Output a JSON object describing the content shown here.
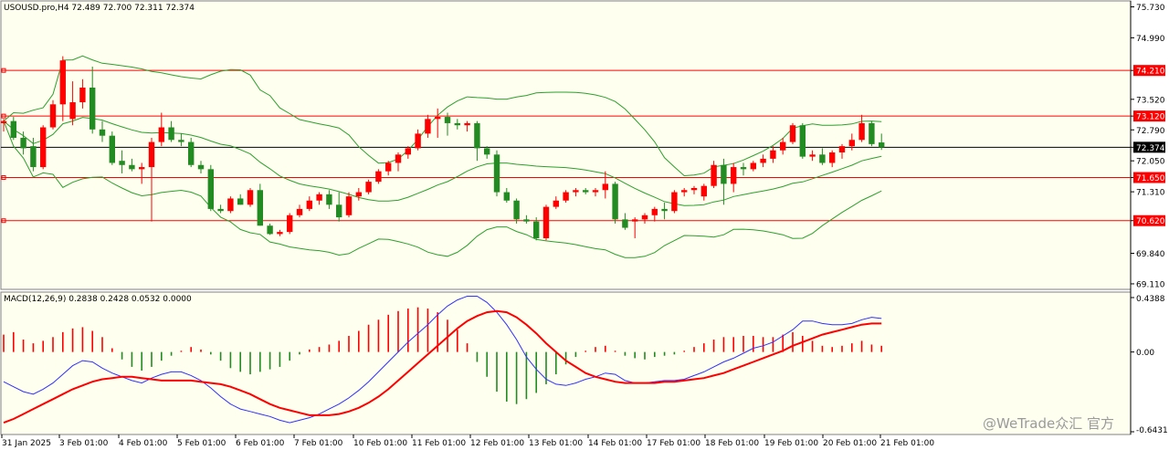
{
  "chart_data": {
    "type": "candlestick",
    "symbol_header": "USOUSD.pro,H4  72.489 72.700 72.311 72.374",
    "macd_header": "MACD(12,26,9) 0.2838 0.2428 0.0532 0.0000",
    "price_axis_labels": [
      "75.730",
      "74.990",
      "74.210",
      "73.520",
      "73.120",
      "72.790",
      "72.374",
      "72.050",
      "71.650",
      "71.310",
      "70.620",
      "69.840",
      "69.110"
    ],
    "macd_axis_labels": [
      "0.4388",
      "0.00",
      "-0.6431"
    ],
    "time_labels": [
      "31 Jan 2025",
      "3 Feb 01:00",
      "4 Feb 01:00",
      "5 Feb 01:00",
      "6 Feb 01:00",
      "7 Feb 01:00",
      "10 Feb 01:00",
      "11 Feb 01:00",
      "12 Feb 01:00",
      "13 Feb 01:00",
      "14 Feb 01:00",
      "17 Feb 01:00",
      "18 Feb 01:00",
      "19 Feb 01:00",
      "20 Feb 01:00",
      "21 Feb 01:00"
    ],
    "price_range": [
      69.0,
      75.85
    ],
    "macd_range": [
      -0.6431,
      0.4388
    ],
    "horizontal_levels": [
      {
        "value": 74.21,
        "label": "74.210",
        "color": "#ff0000"
      },
      {
        "value": 73.12,
        "label": "73.120",
        "color": "#ff0000"
      },
      {
        "value": 71.65,
        "label": "71.650",
        "color": "#ff0000"
      },
      {
        "value": 70.62,
        "label": "70.620",
        "color": "#ff0000"
      },
      {
        "value": 72.374,
        "label": "72.374",
        "color": "#000000"
      }
    ],
    "bollinger_color": "#2ca02c",
    "bull_color": "#ff0000",
    "bear_color": "#228b22",
    "macd_signal_color": "#ff0000",
    "macd_line_color": "#3030ff",
    "candles": [
      {
        "o": 72.95,
        "h": 73.05,
        "l": 72.75,
        "c": 73.0
      },
      {
        "o": 73.0,
        "h": 73.1,
        "l": 72.55,
        "c": 72.6
      },
      {
        "o": 72.6,
        "h": 72.75,
        "l": 72.2,
        "c": 72.35
      },
      {
        "o": 72.4,
        "h": 72.6,
        "l": 71.8,
        "c": 71.9
      },
      {
        "o": 71.9,
        "h": 72.9,
        "l": 71.85,
        "c": 72.85
      },
      {
        "o": 72.85,
        "h": 73.5,
        "l": 72.8,
        "c": 73.4
      },
      {
        "o": 73.4,
        "h": 74.55,
        "l": 73.0,
        "c": 74.45
      },
      {
        "o": 73.05,
        "h": 73.95,
        "l": 72.9,
        "c": 73.45
      },
      {
        "o": 73.45,
        "h": 74.0,
        "l": 73.3,
        "c": 73.8
      },
      {
        "o": 73.8,
        "h": 74.3,
        "l": 72.7,
        "c": 72.8
      },
      {
        "o": 72.8,
        "h": 73.0,
        "l": 72.5,
        "c": 72.65
      },
      {
        "o": 72.65,
        "h": 72.75,
        "l": 71.95,
        "c": 72.0
      },
      {
        "o": 72.05,
        "h": 72.3,
        "l": 71.75,
        "c": 71.95
      },
      {
        "o": 71.95,
        "h": 72.1,
        "l": 71.8,
        "c": 71.85
      },
      {
        "o": 71.85,
        "h": 72.0,
        "l": 71.5,
        "c": 71.9
      },
      {
        "o": 71.9,
        "h": 72.6,
        "l": 70.6,
        "c": 72.5
      },
      {
        "o": 72.5,
        "h": 73.2,
        "l": 72.4,
        "c": 72.85
      },
      {
        "o": 72.85,
        "h": 73.0,
        "l": 72.5,
        "c": 72.55
      },
      {
        "o": 72.55,
        "h": 72.7,
        "l": 72.4,
        "c": 72.5
      },
      {
        "o": 72.5,
        "h": 72.6,
        "l": 71.9,
        "c": 71.95
      },
      {
        "o": 71.95,
        "h": 72.05,
        "l": 71.75,
        "c": 71.85
      },
      {
        "o": 71.85,
        "h": 71.95,
        "l": 70.85,
        "c": 70.9
      },
      {
        "o": 70.9,
        "h": 71.0,
        "l": 70.8,
        "c": 70.85
      },
      {
        "o": 70.85,
        "h": 71.2,
        "l": 70.8,
        "c": 71.15
      },
      {
        "o": 71.15,
        "h": 71.25,
        "l": 71.0,
        "c": 71.0
      },
      {
        "o": 71.0,
        "h": 71.4,
        "l": 70.95,
        "c": 71.35
      },
      {
        "o": 71.35,
        "h": 71.5,
        "l": 70.5,
        "c": 70.5
      },
      {
        "o": 70.5,
        "h": 70.55,
        "l": 70.28,
        "c": 70.3
      },
      {
        "o": 70.3,
        "h": 70.4,
        "l": 70.25,
        "c": 70.35
      },
      {
        "o": 70.35,
        "h": 70.8,
        "l": 70.3,
        "c": 70.75
      },
      {
        "o": 70.75,
        "h": 71.0,
        "l": 70.7,
        "c": 70.9
      },
      {
        "o": 70.9,
        "h": 71.2,
        "l": 70.85,
        "c": 71.1
      },
      {
        "o": 71.1,
        "h": 71.3,
        "l": 71.0,
        "c": 71.25
      },
      {
        "o": 71.25,
        "h": 71.35,
        "l": 70.9,
        "c": 71.0
      },
      {
        "o": 71.0,
        "h": 71.3,
        "l": 70.6,
        "c": 70.7
      },
      {
        "o": 70.75,
        "h": 71.3,
        "l": 70.7,
        "c": 71.2
      },
      {
        "o": 71.2,
        "h": 71.4,
        "l": 71.1,
        "c": 71.3
      },
      {
        "o": 71.3,
        "h": 71.6,
        "l": 71.25,
        "c": 71.55
      },
      {
        "o": 71.55,
        "h": 71.85,
        "l": 71.5,
        "c": 71.8
      },
      {
        "o": 71.8,
        "h": 72.05,
        "l": 71.7,
        "c": 72.0
      },
      {
        "o": 72.0,
        "h": 72.25,
        "l": 71.8,
        "c": 72.2
      },
      {
        "o": 72.2,
        "h": 72.4,
        "l": 72.1,
        "c": 72.35
      },
      {
        "o": 72.35,
        "h": 72.8,
        "l": 72.3,
        "c": 72.7
      },
      {
        "o": 72.7,
        "h": 73.15,
        "l": 72.6,
        "c": 73.05
      },
      {
        "o": 73.05,
        "h": 73.3,
        "l": 72.6,
        "c": 73.1
      },
      {
        "o": 73.1,
        "h": 73.2,
        "l": 72.65,
        "c": 72.95
      },
      {
        "o": 72.95,
        "h": 73.05,
        "l": 72.8,
        "c": 72.9
      },
      {
        "o": 72.9,
        "h": 73.0,
        "l": 72.75,
        "c": 72.95
      },
      {
        "o": 72.95,
        "h": 73.0,
        "l": 72.05,
        "c": 72.35
      },
      {
        "o": 72.35,
        "h": 72.4,
        "l": 72.1,
        "c": 72.2
      },
      {
        "o": 72.2,
        "h": 72.3,
        "l": 71.2,
        "c": 71.3
      },
      {
        "o": 71.3,
        "h": 71.4,
        "l": 71.05,
        "c": 71.1
      },
      {
        "o": 71.1,
        "h": 71.15,
        "l": 70.55,
        "c": 70.65
      },
      {
        "o": 70.65,
        "h": 70.75,
        "l": 70.55,
        "c": 70.6
      },
      {
        "o": 70.6,
        "h": 70.7,
        "l": 70.15,
        "c": 70.2
      },
      {
        "o": 70.2,
        "h": 71.0,
        "l": 70.15,
        "c": 70.95
      },
      {
        "o": 70.95,
        "h": 71.2,
        "l": 70.9,
        "c": 71.1
      },
      {
        "o": 71.1,
        "h": 71.35,
        "l": 71.05,
        "c": 71.3
      },
      {
        "o": 71.3,
        "h": 71.4,
        "l": 71.2,
        "c": 71.35
      },
      {
        "o": 71.35,
        "h": 71.4,
        "l": 71.25,
        "c": 71.3
      },
      {
        "o": 71.3,
        "h": 71.4,
        "l": 71.2,
        "c": 71.35
      },
      {
        "o": 71.35,
        "h": 71.8,
        "l": 71.15,
        "c": 71.5
      },
      {
        "o": 71.5,
        "h": 71.55,
        "l": 70.55,
        "c": 70.65
      },
      {
        "o": 70.65,
        "h": 70.8,
        "l": 70.4,
        "c": 70.45
      },
      {
        "o": 70.6,
        "h": 70.7,
        "l": 70.2,
        "c": 70.65
      },
      {
        "o": 70.65,
        "h": 70.8,
        "l": 70.55,
        "c": 70.75
      },
      {
        "o": 70.75,
        "h": 70.95,
        "l": 70.6,
        "c": 70.9
      },
      {
        "o": 70.9,
        "h": 71.05,
        "l": 70.65,
        "c": 70.85
      },
      {
        "o": 70.85,
        "h": 71.35,
        "l": 70.8,
        "c": 71.3
      },
      {
        "o": 71.3,
        "h": 71.4,
        "l": 71.2,
        "c": 71.35
      },
      {
        "o": 71.35,
        "h": 71.45,
        "l": 71.25,
        "c": 71.4
      },
      {
        "o": 71.2,
        "h": 71.5,
        "l": 71.1,
        "c": 71.45
      },
      {
        "o": 71.45,
        "h": 72.05,
        "l": 71.4,
        "c": 71.95
      },
      {
        "o": 71.95,
        "h": 72.1,
        "l": 71.0,
        "c": 71.5
      },
      {
        "o": 71.5,
        "h": 72.0,
        "l": 71.3,
        "c": 71.9
      },
      {
        "o": 71.9,
        "h": 72.0,
        "l": 71.7,
        "c": 71.85
      },
      {
        "o": 71.85,
        "h": 72.05,
        "l": 71.8,
        "c": 72.0
      },
      {
        "o": 72.0,
        "h": 72.2,
        "l": 71.9,
        "c": 72.1
      },
      {
        "o": 72.1,
        "h": 72.4,
        "l": 72.0,
        "c": 72.3
      },
      {
        "o": 72.3,
        "h": 72.6,
        "l": 72.2,
        "c": 72.5
      },
      {
        "o": 72.5,
        "h": 72.95,
        "l": 72.45,
        "c": 72.9
      },
      {
        "o": 72.9,
        "h": 72.95,
        "l": 72.1,
        "c": 72.15
      },
      {
        "o": 72.15,
        "h": 72.3,
        "l": 72.05,
        "c": 72.2
      },
      {
        "o": 72.2,
        "h": 72.35,
        "l": 71.95,
        "c": 72.0
      },
      {
        "o": 72.0,
        "h": 72.3,
        "l": 71.9,
        "c": 72.25
      },
      {
        "o": 72.25,
        "h": 72.45,
        "l": 72.1,
        "c": 72.4
      },
      {
        "o": 72.4,
        "h": 72.7,
        "l": 72.3,
        "c": 72.55
      },
      {
        "o": 72.55,
        "h": 73.15,
        "l": 72.5,
        "c": 72.95
      },
      {
        "o": 72.95,
        "h": 73.0,
        "l": 72.4,
        "c": 72.45
      },
      {
        "o": 72.489,
        "h": 72.7,
        "l": 72.311,
        "c": 72.374
      }
    ],
    "macd_hist": [
      0.14,
      0.16,
      0.1,
      0.07,
      0.09,
      0.12,
      0.16,
      0.19,
      0.2,
      0.17,
      0.12,
      0.03,
      -0.06,
      -0.12,
      -0.15,
      -0.12,
      -0.07,
      -0.03,
      0.01,
      0.04,
      0.02,
      -0.02,
      -0.07,
      -0.13,
      -0.16,
      -0.18,
      -0.16,
      -0.14,
      -0.12,
      -0.07,
      -0.02,
      0.02,
      0.04,
      0.06,
      0.09,
      0.13,
      0.17,
      0.22,
      0.26,
      0.3,
      0.33,
      0.35,
      0.36,
      0.35,
      0.32,
      0.26,
      0.18,
      0.07,
      -0.08,
      -0.2,
      -0.32,
      -0.4,
      -0.42,
      -0.38,
      -0.33,
      -0.26,
      -0.18,
      -0.1,
      -0.04,
      0.01,
      0.04,
      0.05,
      0.01,
      -0.03,
      -0.05,
      -0.06,
      -0.04,
      -0.03,
      -0.02,
      0.01,
      0.04,
      0.07,
      0.1,
      0.12,
      0.12,
      0.13,
      0.13,
      0.12,
      0.12,
      0.14,
      0.16,
      0.13,
      0.09,
      0.05,
      0.04,
      0.05,
      0.07,
      0.09,
      0.06,
      0.05
    ],
    "macd_line": [
      -0.24,
      -0.28,
      -0.32,
      -0.34,
      -0.3,
      -0.25,
      -0.18,
      -0.11,
      -0.07,
      -0.08,
      -0.13,
      -0.17,
      -0.2,
      -0.23,
      -0.25,
      -0.21,
      -0.18,
      -0.16,
      -0.16,
      -0.19,
      -0.23,
      -0.29,
      -0.36,
      -0.42,
      -0.46,
      -0.48,
      -0.5,
      -0.52,
      -0.55,
      -0.57,
      -0.55,
      -0.53,
      -0.5,
      -0.46,
      -0.42,
      -0.37,
      -0.31,
      -0.24,
      -0.16,
      -0.08,
      0.0,
      0.08,
      0.15,
      0.22,
      0.3,
      0.37,
      0.42,
      0.45,
      0.45,
      0.4,
      0.32,
      0.22,
      0.1,
      -0.04,
      -0.14,
      -0.22,
      -0.26,
      -0.27,
      -0.25,
      -0.22,
      -0.2,
      -0.17,
      -0.18,
      -0.23,
      -0.25,
      -0.25,
      -0.24,
      -0.23,
      -0.23,
      -0.22,
      -0.19,
      -0.16,
      -0.12,
      -0.08,
      -0.05,
      -0.01,
      0.03,
      0.05,
      0.08,
      0.13,
      0.18,
      0.25,
      0.25,
      0.23,
      0.22,
      0.22,
      0.23,
      0.26,
      0.28,
      0.27
    ],
    "macd_signal": [
      -0.57,
      -0.54,
      -0.5,
      -0.46,
      -0.42,
      -0.38,
      -0.34,
      -0.3,
      -0.27,
      -0.24,
      -0.22,
      -0.21,
      -0.2,
      -0.2,
      -0.21,
      -0.22,
      -0.23,
      -0.23,
      -0.23,
      -0.23,
      -0.24,
      -0.25,
      -0.26,
      -0.28,
      -0.31,
      -0.34,
      -0.38,
      -0.42,
      -0.45,
      -0.47,
      -0.49,
      -0.51,
      -0.51,
      -0.51,
      -0.5,
      -0.48,
      -0.45,
      -0.41,
      -0.36,
      -0.3,
      -0.23,
      -0.16,
      -0.09,
      -0.02,
      0.05,
      0.12,
      0.19,
      0.25,
      0.29,
      0.32,
      0.33,
      0.32,
      0.28,
      0.22,
      0.15,
      0.07,
      0.0,
      -0.07,
      -0.12,
      -0.17,
      -0.2,
      -0.22,
      -0.24,
      -0.25,
      -0.25,
      -0.25,
      -0.25,
      -0.24,
      -0.24,
      -0.23,
      -0.22,
      -0.21,
      -0.19,
      -0.17,
      -0.14,
      -0.11,
      -0.08,
      -0.05,
      -0.02,
      0.01,
      0.05,
      0.08,
      0.11,
      0.14,
      0.16,
      0.18,
      0.2,
      0.22,
      0.23,
      0.23
    ]
  },
  "watermark": "@WeTrade众汇 官方"
}
